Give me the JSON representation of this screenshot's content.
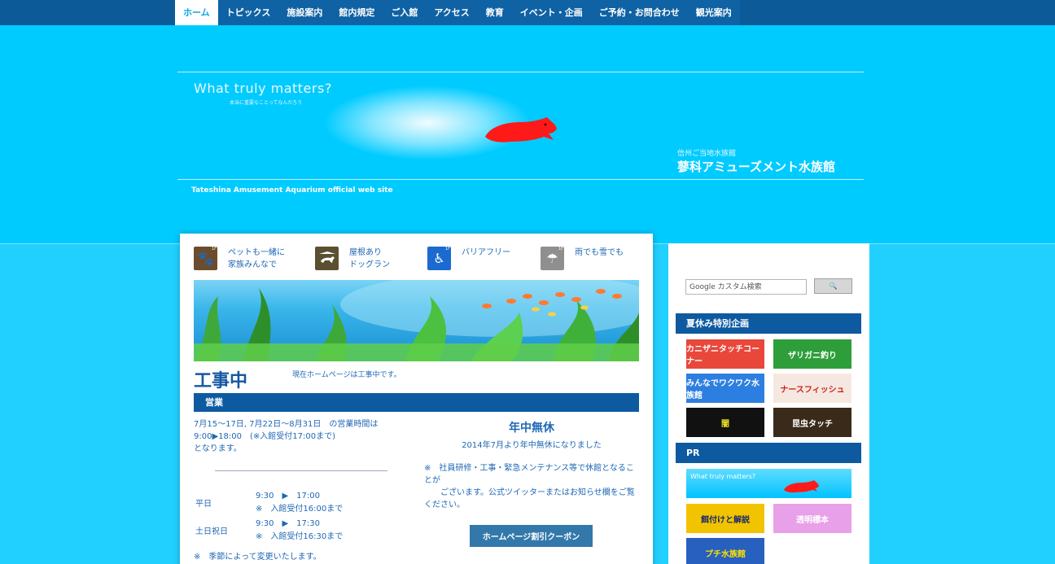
{
  "nav": {
    "items": [
      "ホーム",
      "トピックス",
      "施設案内",
      "館内規定",
      "ご入館",
      "アクセス",
      "教育",
      "イベント・企画",
      "ご予約・お問合わせ",
      "観光案内"
    ],
    "active_index": 0
  },
  "header": {
    "tagline": "What truly matters?",
    "tagline_sub": "本当に重要なことってなんだろう",
    "logo_sub": "信州ご当地水族館",
    "logo_title": "蓼科アミューズメント水族館",
    "site_caption": "Tateshina Amusement Aquarium official web site"
  },
  "features": [
    {
      "icon": "paw-icon",
      "lines": [
        "ペットも一緒に",
        "家族みんなで"
      ]
    },
    {
      "icon": "dog-run-icon",
      "lines": [
        "屋根あり",
        "ドッグラン"
      ]
    },
    {
      "icon": "wheelchair-icon",
      "lines": [
        "バリアフリー",
        ""
      ]
    },
    {
      "icon": "umbrella-icon",
      "lines": [
        "雨でも雪でも",
        ""
      ]
    }
  ],
  "feature_tag": "1F",
  "main": {
    "title": "工事中",
    "title_note": "現在ホームページは工事中です。",
    "section_label": "営業",
    "hours_lines": [
      "7月15〜17日, 7月22日〜8月31日　の営業時間は",
      "9:00▶18:00　(※入館受付17:00まで)",
      "となります。"
    ],
    "schedule": [
      {
        "day": "平日",
        "time1": "9:30　▶　17:00",
        "time2": "※　入館受付16:00まで"
      },
      {
        "day": "土日祝日",
        "time1": "9:30　▶　17:30",
        "time2": "※　入館受付16:30まで"
      }
    ],
    "season_note": "※　季節によって変更いたします。",
    "open_title": "年中無休",
    "open_sub": "2014年7月より年中無休になりました",
    "notice_lines": [
      "※　社員研修・工事・緊急メンテナンス等で休館となることが",
      "　　ございます。公式ツイッターまたはお知らせ欄をご覧ください。"
    ],
    "coupon_label": "ホームページ割引クーポン"
  },
  "sidebar": {
    "search_brand": "Google",
    "search_placeholder": "カスタム検索",
    "search_button": "🔍",
    "summer_head": "夏休み特別企画",
    "summer_banners": [
      {
        "label": "カニザニタッチコーナー",
        "bg": "#e8473a",
        "fg": "#ffffff"
      },
      {
        "label": "ザリガニ釣り",
        "bg": "#2e9e3a",
        "fg": "#ffffff"
      },
      {
        "label": "みんなでワクワク水族館",
        "bg": "#2c7fe0",
        "fg": "#ffffff"
      },
      {
        "label": "ナースフィッシュ",
        "bg": "#f4e8e0",
        "fg": "#d02020"
      },
      {
        "label": "闇",
        "bg": "#111111",
        "fg": "#f0e020"
      },
      {
        "label": "昆虫タッチ",
        "bg": "#3a2a1a",
        "fg": "#ffffff"
      }
    ],
    "pr_head": "PR",
    "pr_banner_text": "What truly matters?",
    "pr_banners": [
      {
        "label": "餌付けと解説",
        "bg": "#f2c300",
        "fg": "#1a2a6a"
      },
      {
        "label": "透明標本",
        "bg": "#e8a0e8",
        "fg": "#ffffff"
      },
      {
        "label": "プチ水族館",
        "bg": "#2860c0",
        "fg": "#ffe000"
      }
    ]
  }
}
